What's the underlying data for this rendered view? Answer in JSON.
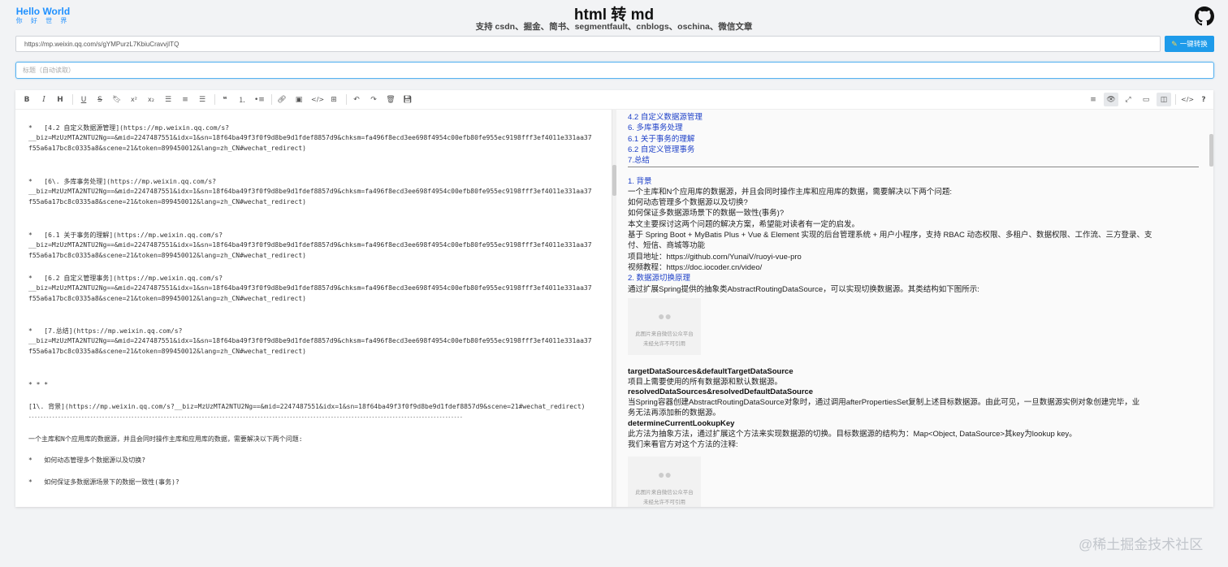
{
  "header": {
    "logo_line1": "Hello World",
    "logo_line2": "你 好 世 界",
    "title": "html 转 md",
    "subtitle": "支持 csdn、掘金、简书、segmentfault、cnblogs、oschina、微信文章",
    "github_icon": "github-icon"
  },
  "url_bar": {
    "value": "https://mp.weixin.qq.com/s/gYMPurzL7KbiuCravvjITQ",
    "convert_label": "一键转换"
  },
  "title_field": {
    "placeholder": "标题（自动读取）"
  },
  "toolbar": {
    "left_icons": [
      "bold-icon",
      "italic-icon",
      "heading-icon",
      "underline-icon",
      "strikethrough-icon",
      "bookmark-icon",
      "superscript-icon",
      "subscript-icon",
      "align-left-icon",
      "align-center-icon",
      "align-right-icon",
      "quote-icon",
      "ordered-list-icon",
      "unordered-list-icon",
      "link-icon",
      "image-icon",
      "code-icon",
      "table-icon",
      "undo-icon",
      "redo-icon",
      "trash-icon",
      "save-icon"
    ],
    "right_icons": [
      "menu-icon",
      "eye-icon",
      "fullscreen-icon",
      "window-icon",
      "split-view-icon",
      "code-view-icon",
      "help-icon"
    ]
  },
  "markdown_source": {
    "lines": [
      "*   [4.2 自定义数据源管理](https://mp.weixin.qq.com/s?",
      "__biz=MzUzMTA2NTU2Ng==&mid=2247487551&idx=1&sn=18f64ba49f3f0f9d8be9d1fdef8857d9&chksm=fa496f8ecd3ee698f4954c00efb80fe955ec9198fff3ef4011e331aa37",
      "f55a6a17bc8c0335a8&scene=21&token=899450012&lang=zh_CN#wechat_redirect)",
      "*   [6\\. 多库事务处理](https://mp.weixin.qq.com/s?",
      "__biz=MzUzMTA2NTU2Ng==&mid=2247487551&idx=1&sn=18f64ba49f3f0f9d8be9d1fdef8857d9&chksm=fa496f8ecd3ee698f4954c00efb80fe955ec9198fff3ef4011e331aa37",
      "f55a6a17bc8c0335a8&scene=21&token=899450012&lang=zh_CN#wechat_redirect)",
      "*   [6.1 关于事务的理解](https://mp.weixin.qq.com/s?",
      "__biz=MzUzMTA2NTU2Ng==&mid=2247487551&idx=1&sn=18f64ba49f3f0f9d8be9d1fdef8857d9&chksm=fa496f8ecd3ee698f4954c00efb80fe955ec9198fff3ef4011e331aa37",
      "f55a6a17bc8c0335a8&scene=21&token=899450012&lang=zh_CN#wechat_redirect)",
      "*   [6.2 自定义管理事务](https://mp.weixin.qq.com/s?",
      "__biz=MzUzMTA2NTU2Ng==&mid=2247487551&idx=1&sn=18f64ba49f3f0f9d8be9d1fdef8857d9&chksm=fa496f8ecd3ee698f4954c00efb80fe955ec9198fff3ef4011e331aa37",
      "f55a6a17bc8c0335a8&scene=21&token=899450012&lang=zh_CN#wechat_redirect)",
      "*   [7.总结](https://mp.weixin.qq.com/s?",
      "__biz=MzUzMTA2NTU2Ng==&mid=2247487551&idx=1&sn=18f64ba49f3f0f9d8be9d1fdef8857d9&chksm=fa496f8ecd3ee698f4954c00efb80fe955ec9198fff3ef4011e331aa37",
      "f55a6a17bc8c0335a8&scene=21&token=899450012&lang=zh_CN#wechat_redirect)",
      "* * *",
      "[1\\. 背景](https://mp.weixin.qq.com/s?__biz=MzUzMTA2NTU2Ng==&mid=2247487551&idx=1&sn=18f64ba49f3f0f9d8be9d1fdef8857d9&scene=21#wechat_redirect)",
      "----------------------------------------------------------------------------------------------------------------------------------------------------",
      "一个主库和N个应用库的数据源，并且会同时操作主库和应用库的数据，需要解决以下两个问题:",
      "*   如何动态管理多个数据源以及切换?",
      "*   如何保证多数据源场景下的数据一致性(事务)?"
    ]
  },
  "preview": {
    "toc": [
      "4.2 自定义数据源管理",
      "6. 多库事务处理",
      "6.1 关于事务的理解",
      "6.2 自定义管理事务",
      "7.总结"
    ],
    "section1_heading": "1. 背景",
    "section1_lines": [
      "一个主库和N个应用库的数据源，并且会同时操作主库和应用库的数据，需要解决以下两个问题:",
      "如何动态管理多个数据源以及切换?",
      "如何保证多数据源场景下的数据一致性(事务)?",
      "本文主要探讨这两个问题的解决方案，希望能对读者有一定的启发。",
      "基于 Spring Boot + MyBatis Plus + Vue & Element 实现的后台管理系统 + 用户小程序，支持 RBAC 动态权限、多租户、数据权限、工作流、三方登录、支",
      "付、短信、商城等功能",
      "项目地址：https://github.com/YunaiV/ruoyi-vue-pro",
      "视频教程：https://doc.iocoder.cn/video/"
    ],
    "section2_heading": "2. 数据源切换原理",
    "section2_intro": "通过扩展Spring提供的抽象类AbstractRoutingDataSource，可以实现切换数据源。其类结构如下图所示:",
    "image_caption_line1": "此图片来自微信公众平台",
    "image_caption_line2": "未经允许不可引用",
    "term1": "targetDataSources&defaultTargetDataSource",
    "term1_desc": "项目上需要使用的所有数据源和默认数据源。",
    "term2": "resolvedDataSources&resolvedDefaultDataSource",
    "term2_desc_1": "当Spring容器创建AbstractRoutingDataSource对象时，通过调用afterPropertiesSet复制上述目标数据源。由此可见，一旦数据源实例对象创建完毕，业",
    "term2_desc_2": "务无法再添加新的数据源。",
    "term3": "determineCurrentLookupKey",
    "term3_desc": "此方法为抽象方法，通过扩展这个方法来实现数据源的切换。目标数据源的结构为：Map<Object, DataSource>其key为lookup key。",
    "term3_note": "我们来看官方对这个方法的注释:"
  },
  "watermark": "@稀土掘金技术社区",
  "colors": {
    "accent": "#1e9bea",
    "link": "#1e40c8"
  }
}
